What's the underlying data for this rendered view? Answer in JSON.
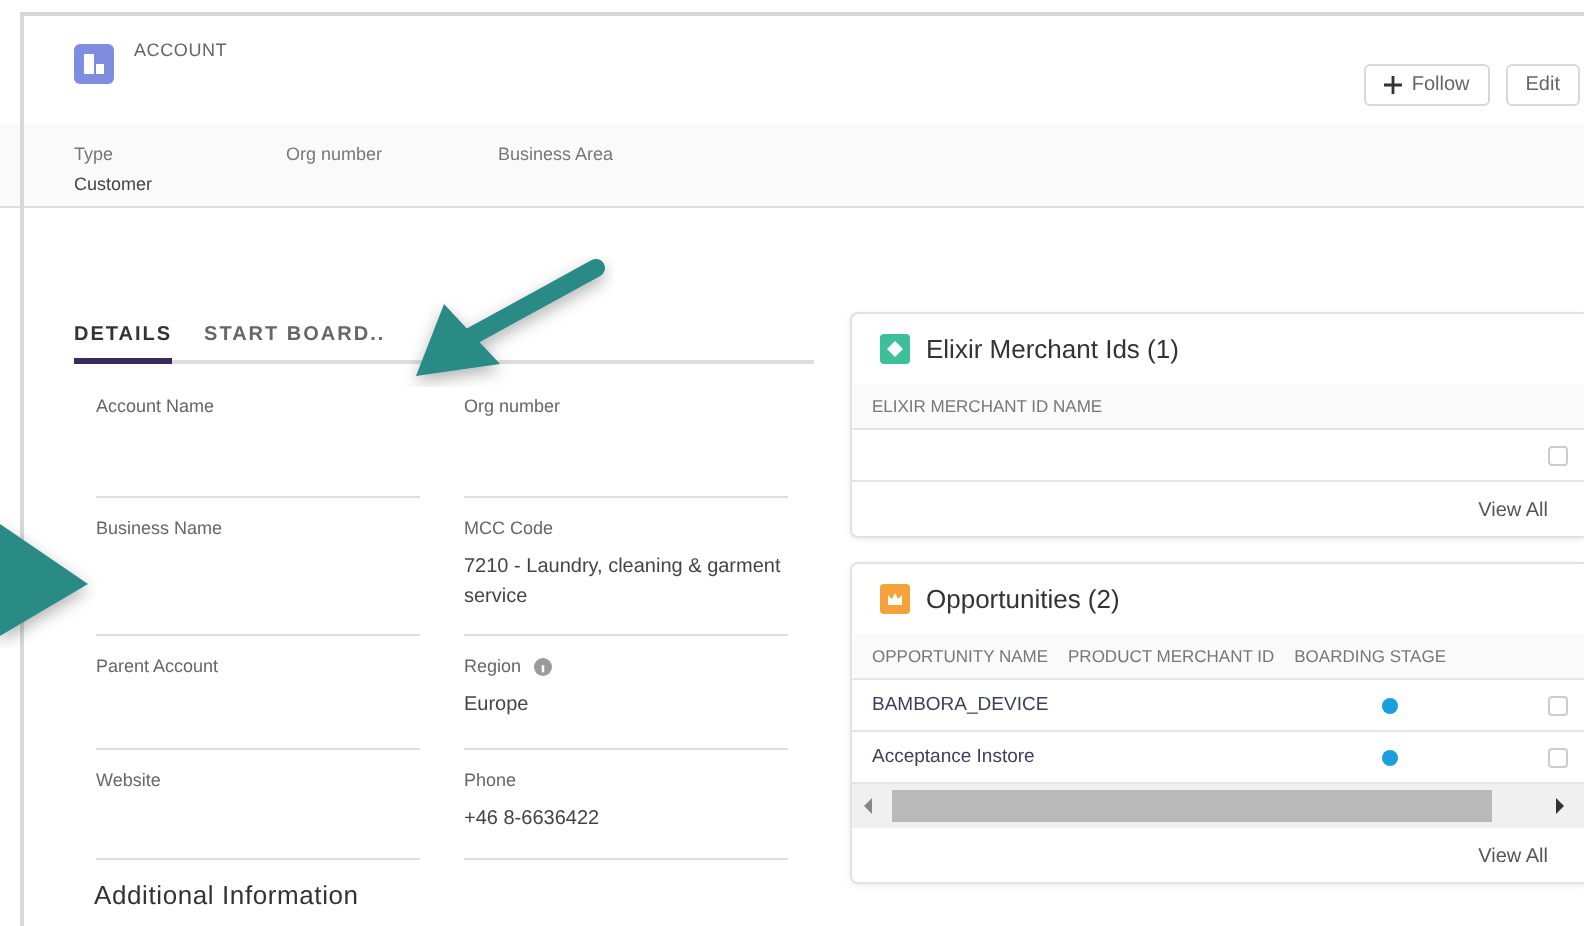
{
  "header": {
    "object_label": "ACCOUNT",
    "buttons": [
      {
        "label": "Follow",
        "kind": "follow"
      },
      {
        "label": "Edit",
        "kind": "plain"
      }
    ],
    "highlights": [
      {
        "label": "Type",
        "value": "Customer"
      },
      {
        "label": "Org number"
      },
      {
        "label": "Business Area"
      }
    ]
  },
  "tabs": [
    {
      "label": "DETAILS",
      "selected": true
    },
    {
      "label": "START BOARD..",
      "selected": false
    }
  ],
  "fields": [
    [
      {
        "label": "Account Name"
      },
      {
        "label": "Org number"
      }
    ],
    [
      {
        "label": "Business Name"
      },
      {
        "label": "MCC Code",
        "value": "7210 - Laundry, cleaning & garment service"
      }
    ],
    [
      {
        "label": "Parent Account"
      },
      {
        "label": "Region",
        "info": true,
        "value": "Europe"
      }
    ],
    [
      {
        "label": "Website"
      },
      {
        "label": "Phone",
        "value": "+46 8-6636422"
      }
    ]
  ],
  "section_title": "Additional Information",
  "related": [
    {
      "kind": "elixir",
      "title": "Elixir Merchant Ids (1)",
      "columns": [
        "ELIXIR MERCHANT ID NAME"
      ],
      "rows": [
        {}
      ],
      "view_all": "View All"
    },
    {
      "kind": "opportunities",
      "title": "Opportunities (2)",
      "columns": [
        "OPPORTUNITY NAME",
        "PRODUCT MERCHANT ID",
        "BOARDING STAGE"
      ],
      "rows": [
        {
          "name": "BAMBORA_DEVICE"
        },
        {
          "name": "Acceptance Instore"
        }
      ],
      "view_all": "View All"
    }
  ]
}
